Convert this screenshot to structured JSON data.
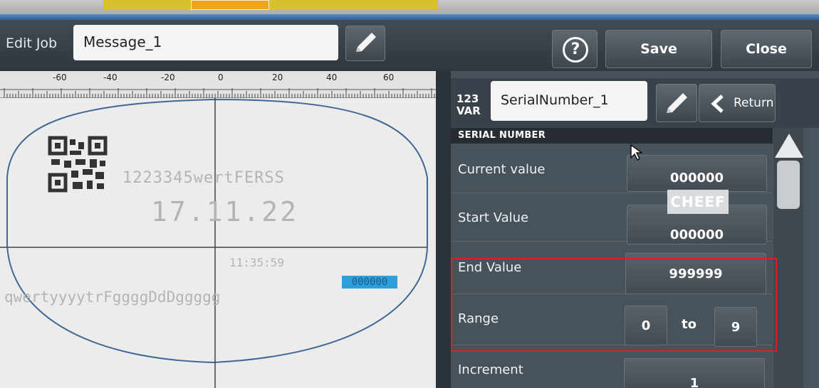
{
  "header": {
    "edit_job_label": "Edit Job",
    "job_name": "Message_1",
    "save_label": "Save",
    "close_label": "Close",
    "help_symbol": "?"
  },
  "canvas": {
    "ruler_labels": [
      "-60",
      "-40",
      "-20",
      "0",
      "20",
      "40",
      "60"
    ],
    "text_line_1": "1223345wertFERSS",
    "date_text": "17.11.22",
    "time_text": "11:35:59",
    "text_line_2": "qwertyyyytrFggggDdDggggg",
    "serial_preview": "000000"
  },
  "variable": {
    "type_top": "123",
    "type_bottom": "VAR",
    "name": "SerialNumber_1",
    "return_label": "Return"
  },
  "serial_number": {
    "section_title": "SERIAL NUMBER",
    "current_value_label": "Current value",
    "current_value": "000000",
    "start_value_label": "Start Value",
    "start_value": "000000",
    "end_value_label": "End Value",
    "end_value": "999999",
    "range_label": "Range",
    "range_from": "0",
    "range_to_label": "to",
    "range_to": "9",
    "increment_label": "Increment",
    "increment": "1"
  },
  "watermark": "CHEEF",
  "colors": {
    "header_bg": "#3a434b",
    "panel_bg": "#48525a",
    "highlight_border": "#d9202a",
    "serial_highlight": "#2f9fdb",
    "canvas_bg": "#ecedea"
  }
}
